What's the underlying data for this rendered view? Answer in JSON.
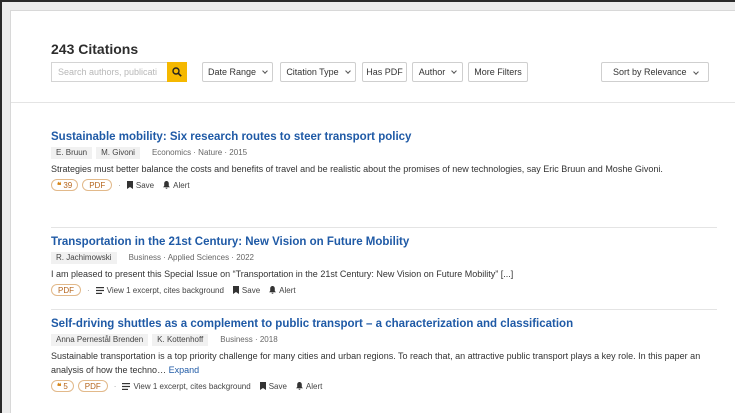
{
  "header": {
    "title": "243 Citations",
    "search_placeholder": "Search authors, publicati",
    "filters": {
      "date_range": "Date Range",
      "citation_type": "Citation Type",
      "has_pdf": "Has PDF",
      "author": "Author",
      "more_filters": "More Filters"
    },
    "sort_label": "Sort by Relevance"
  },
  "results": [
    {
      "title": "Sustainable mobility: Six research routes to steer transport policy",
      "authors": [
        "E. Bruun",
        "M. Givoni"
      ],
      "meta": "Economics · Nature · 2015",
      "abstract": "Strategies must better balance the costs and benefits of travel and be realistic about the promises of new technologies, say Eric Bruun and Moshe Givoni.",
      "citations": "39",
      "pdf": "PDF",
      "save": "Save",
      "alert": "Alert"
    },
    {
      "title": "Transportation in the 21st Century: New Vision on Future Mobility",
      "authors": [
        "R. Jachimowski"
      ],
      "meta": "Business · Applied Sciences · 2022",
      "abstract": "I am pleased to present this Special Issue on “Transportation in the 21st Century: New Vision on Future Mobility” [...]",
      "pdf": "PDF",
      "excerpt": "View 1 excerpt, cites background",
      "save": "Save",
      "alert": "Alert"
    },
    {
      "title": "Self-driving shuttles as a complement to public transport – a characterization and classification",
      "authors": [
        "Anna Pernestål Brenden",
        "K. Kottenhoff"
      ],
      "meta": "Business · 2018",
      "abstract": "Sustainable transportation is a top priority challenge for many cities and urban regions. To reach that, an attractive public transport plays a key role. In this paper an analysis of how the techno…",
      "expand": "Expand",
      "citations": "5",
      "pdf": "PDF",
      "excerpt": "View 1 excerpt, cites background",
      "save": "Save",
      "alert": "Alert"
    }
  ],
  "colors": {
    "accent": "#f5b800",
    "link": "#1f5aa6",
    "badge": "#b5651d"
  }
}
